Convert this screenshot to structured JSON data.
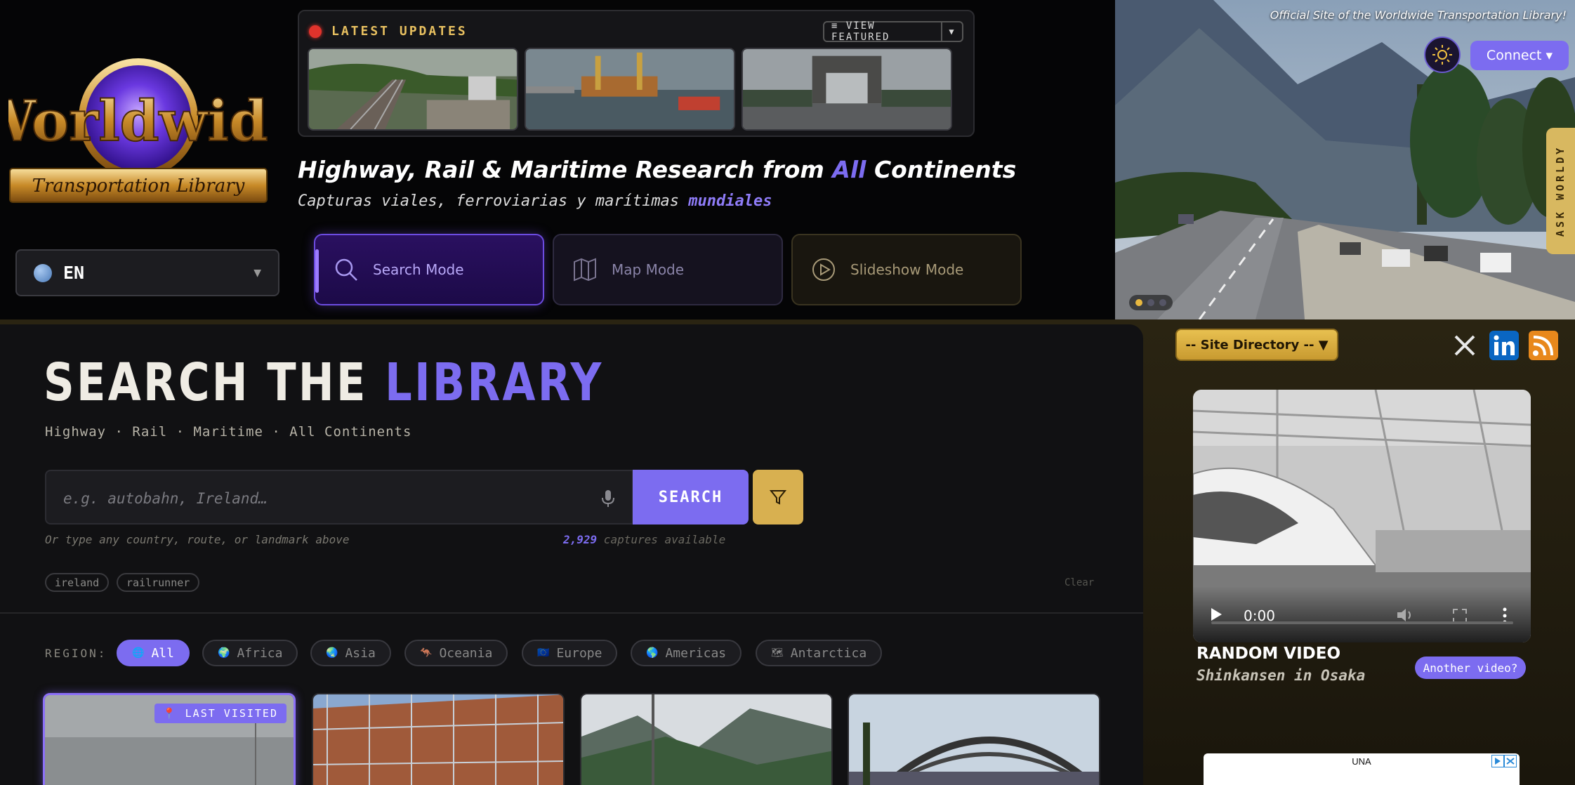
{
  "language": {
    "current": "EN"
  },
  "updates": {
    "title": "LATEST UPDATES",
    "view_featured_label": "≡ VIEW FEATURED"
  },
  "headline": {
    "prefix": "Highway, Rail & Maritime Research from ",
    "accent": "All",
    "suffix": " Continents"
  },
  "subline": {
    "prefix": "Capturas viales, ferroviarias y marítimas ",
    "accent": "mundiales"
  },
  "modes": [
    {
      "label": "Search Mode",
      "icon": "search-icon"
    },
    {
      "label": "Map Mode",
      "icon": "map-icon"
    },
    {
      "label": "Slideshow Mode",
      "icon": "play-icon"
    }
  ],
  "hero": {
    "note": "Official Site of the Worldwide Transportation Library!",
    "connect_label": "Connect ▾",
    "ask_tab": "ASK WORLDY",
    "slides": 3,
    "active_slide": 1
  },
  "search": {
    "title_plain": "SEARCH THE ",
    "title_accent": "LIBRARY",
    "crumbs": "Highway · Rail · Maritime · All Continents",
    "placeholder": "e.g. autobahn, Ireland…",
    "button_label": "SEARCH",
    "hint": "Or type any country, route, or landmark above",
    "count_value": "2,929",
    "count_suffix": " captures available",
    "recent_chips": [
      "ireland",
      "railrunner"
    ],
    "clear_label": "Clear"
  },
  "regions": {
    "label": "REGION:",
    "items": [
      {
        "label": "All",
        "icon": "globe-icon",
        "active": true
      },
      {
        "label": "Africa",
        "icon": "africa-globe-icon",
        "active": false
      },
      {
        "label": "Asia",
        "icon": "asia-globe-icon",
        "active": false
      },
      {
        "label": "Oceania",
        "icon": "kangaroo-icon",
        "active": false
      },
      {
        "label": "Europe",
        "icon": "eu-flag-icon",
        "active": false
      },
      {
        "label": "Americas",
        "icon": "americas-globe-icon",
        "active": false
      },
      {
        "label": "Antarctica",
        "icon": "snow-map-icon",
        "active": false
      }
    ]
  },
  "cards": {
    "last_visited_badge": "📍 LAST VISITED"
  },
  "sidebar": {
    "site_directory": "-- Site Directory -- ▼",
    "social": [
      "x-icon",
      "linkedin-icon",
      "rss-icon"
    ],
    "video": {
      "time": "0:00"
    },
    "random_video_title": "RANDOM VIDEO",
    "random_video_subtitle": "Shinkansen in Osaka",
    "another_label": "Another video?",
    "ad_text": "UNA"
  },
  "colors": {
    "accent_purple": "#7c6cf0",
    "accent_gold": "#d8b050",
    "background": "#0b0b0d"
  }
}
